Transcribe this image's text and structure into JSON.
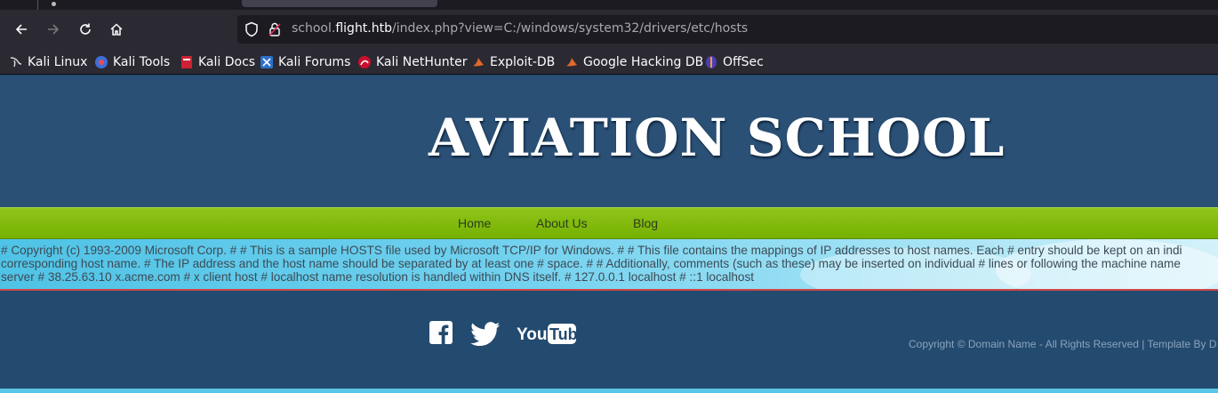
{
  "browser": {
    "url_prefix": "school.",
    "url_host": "flight.htb",
    "url_path": "/index.php?view=C:/windows/system32/drivers/etc/hosts",
    "bookmarks": [
      {
        "label": "Kali Linux",
        "icon": "kali-dragon-icon"
      },
      {
        "label": "Kali Tools",
        "icon": "kali-tools-icon"
      },
      {
        "label": "Kali Docs",
        "icon": "kali-docs-icon"
      },
      {
        "label": "Kali Forums",
        "icon": "kali-forums-icon"
      },
      {
        "label": "Kali NetHunter",
        "icon": "nethunter-icon"
      },
      {
        "label": "Exploit-DB",
        "icon": "exploit-db-icon"
      },
      {
        "label": "Google Hacking DB",
        "icon": "ghdb-icon"
      },
      {
        "label": "OffSec",
        "icon": "offsec-icon"
      }
    ]
  },
  "site": {
    "title": "AVIATION SCHOOL",
    "menu": [
      {
        "label": "Home"
      },
      {
        "label": "About Us"
      },
      {
        "label": "Blog"
      }
    ],
    "content_lines": [
      "# Copyright (c) 1993-2009 Microsoft Corp. # # This is a sample HOSTS file used by Microsoft TCP/IP for Windows. # # This file contains the mappings of IP addresses to host names. Each # entry should be kept on an indi",
      "corresponding host name. # The IP address and the host name should be separated by at least one # space. # # Additionally, comments (such as these) may be inserted on individual # lines or following the machine name",
      "server # 38.25.63.10 x.acme.com # x client host # localhost name resolution is handled within DNS itself. # 127.0.0.1 localhost # ::1 localhost"
    ],
    "footer": {
      "copyright": "Copyright © Domain Name - All Rights Reserved | Template By D",
      "social": [
        "facebook-icon",
        "twitter-icon",
        "youtube-icon"
      ],
      "youtube_text": "YouTube"
    }
  },
  "colors": {
    "header_bg": "#2a5076",
    "menu_green": "#7fbb00",
    "content_sky": "#5cc8ea",
    "footer_bg": "#234a6f"
  }
}
